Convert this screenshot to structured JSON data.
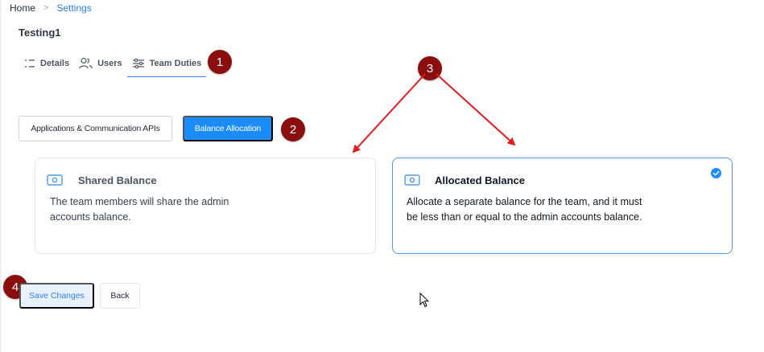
{
  "breadcrumb": {
    "home": "Home",
    "separator": ">",
    "current": "Settings"
  },
  "page_title": "Testing1",
  "tabs": [
    {
      "label": "Details",
      "icon": "list-icon"
    },
    {
      "label": "Users",
      "icon": "users-icon"
    },
    {
      "label": "Team Duties",
      "icon": "sliders-icon",
      "active": true
    }
  ],
  "markers": {
    "m1": "1",
    "m2": "2",
    "m3": "3",
    "m4": "4"
  },
  "section_buttons": {
    "applications": "Applications & Communication APIs",
    "balance": "Balance Allocation"
  },
  "cards": {
    "shared": {
      "title": "Shared Balance",
      "description": "The team members will share the admin accounts balance.",
      "icon": "cash-icon",
      "selected": false
    },
    "allocated": {
      "title": "Allocated Balance",
      "description": "Allocate a separate balance for the team, and it must be less than or equal to the admin accounts balance.",
      "icon": "cash-icon",
      "selected": true
    }
  },
  "actions": {
    "save": "Save Changes",
    "back": "Back"
  },
  "colors": {
    "accent": "#1a8cff",
    "link": "#2f80ed",
    "marker": "#8b0e0e",
    "arrow": "#e01b1b",
    "selected_border": "#4b9ce8"
  }
}
